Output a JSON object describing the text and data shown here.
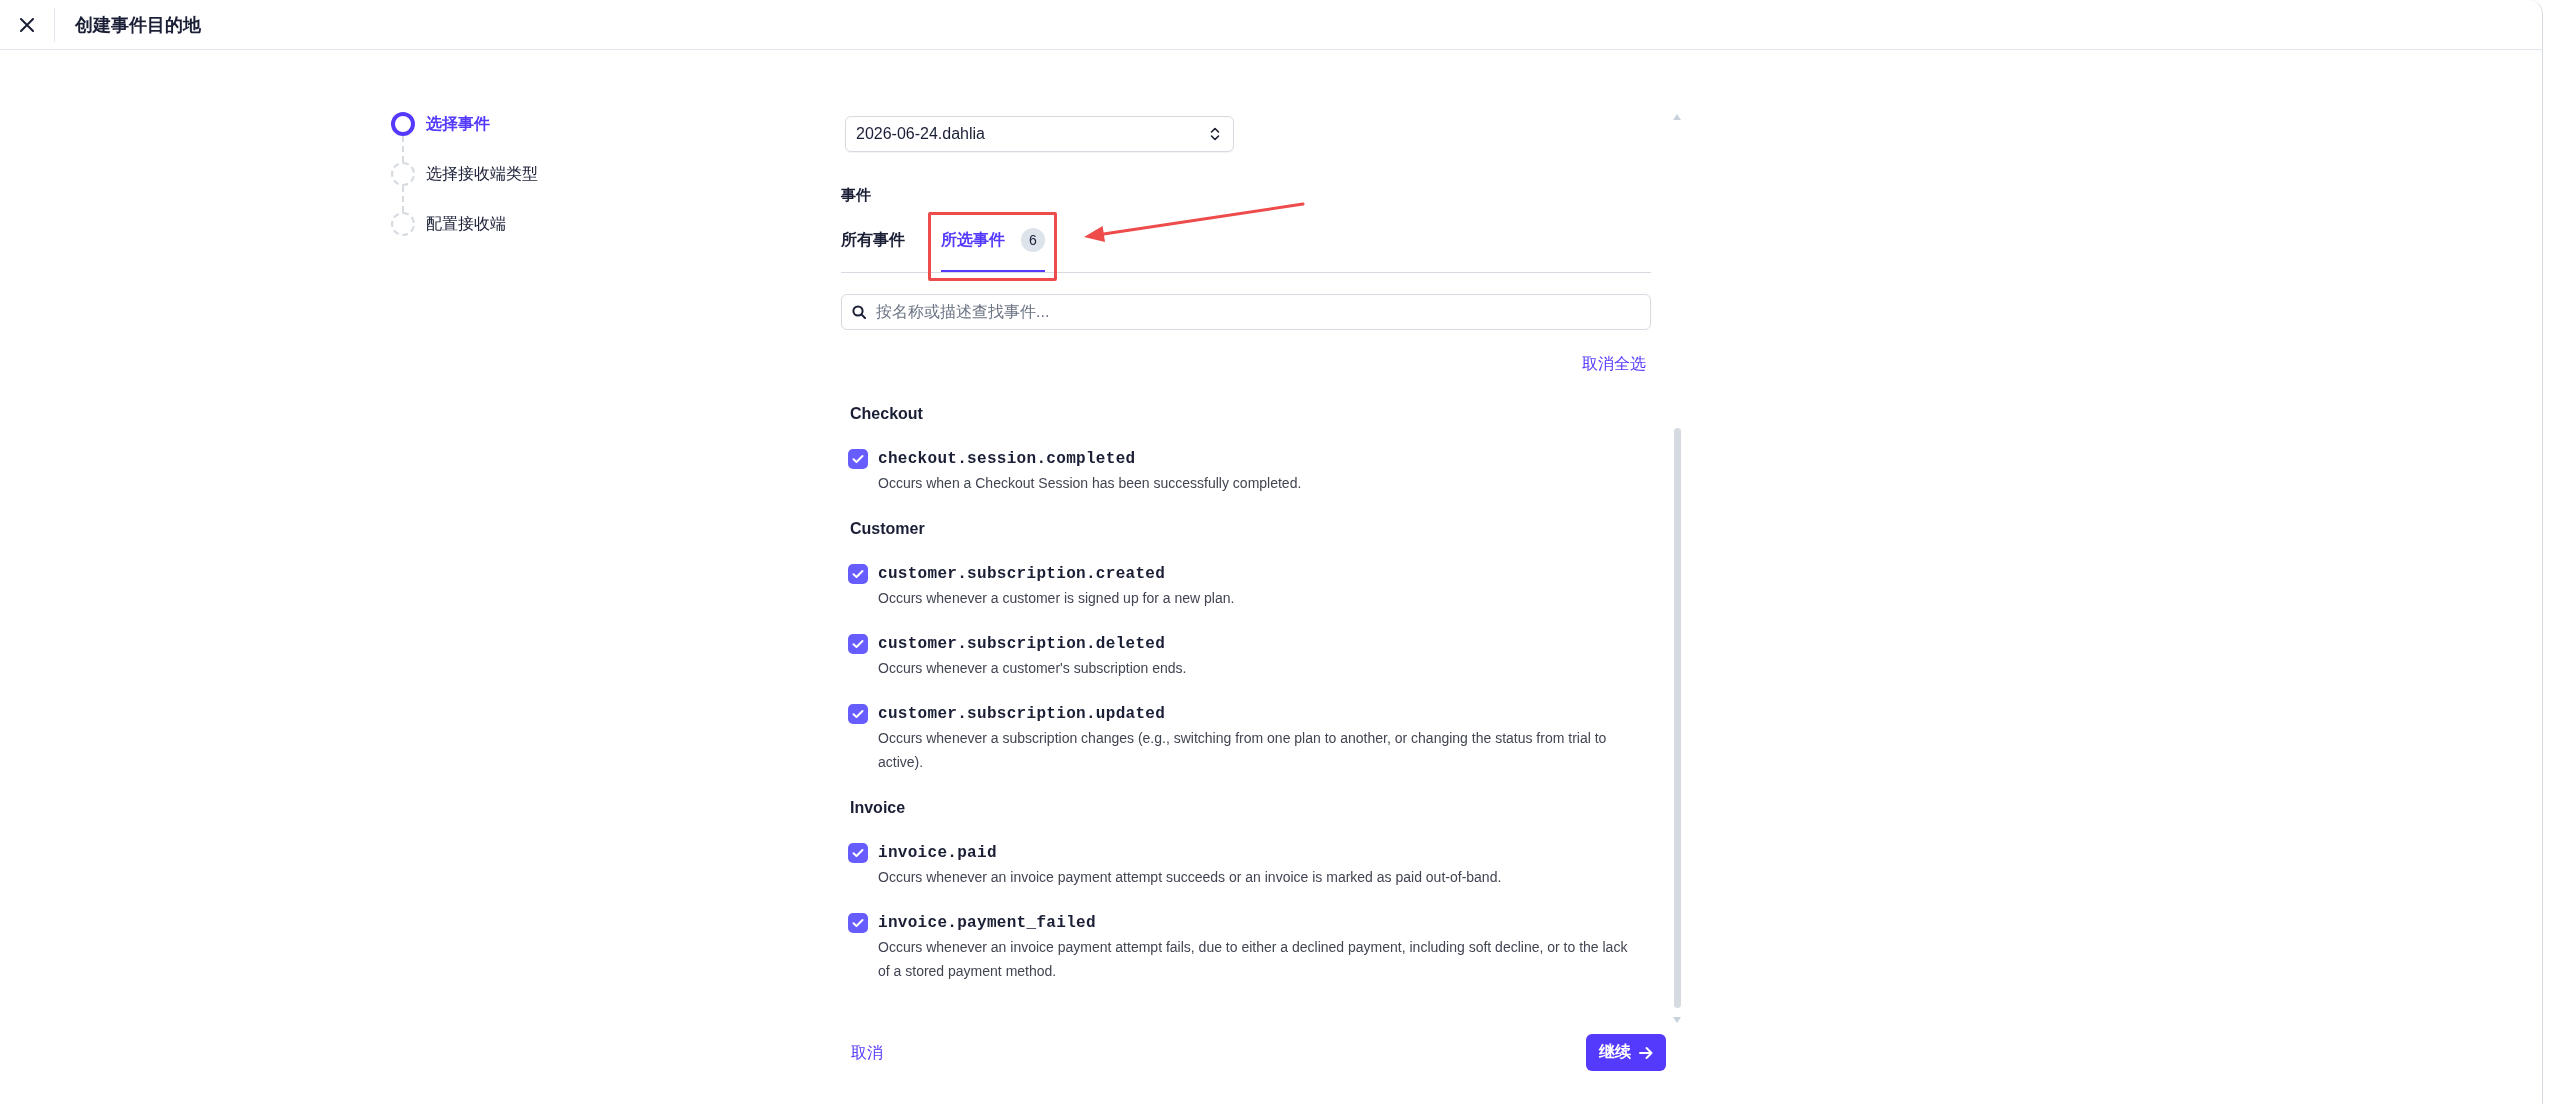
{
  "header": {
    "title": "创建事件目的地"
  },
  "steps": [
    {
      "label": "选择事件",
      "selected": true
    },
    {
      "label": "选择接收端类型",
      "selected": false
    },
    {
      "label": "配置接收端",
      "selected": false
    }
  ],
  "version_select": {
    "value": "2026-06-24.dahlia"
  },
  "events_section": {
    "label": "事件",
    "tabs": [
      {
        "label": "所有事件",
        "selected": false,
        "highlighted": false
      },
      {
        "label": "所选事件",
        "selected": true,
        "highlighted": true,
        "count": "6"
      }
    ],
    "search": {
      "placeholder": "按名称或描述查找事件..."
    },
    "deselect_all": "取消全选",
    "groups": [
      {
        "title": "Checkout",
        "events": [
          {
            "name": "checkout.session.completed",
            "description": "Occurs when a Checkout Session has been successfully completed.",
            "checked": true
          }
        ]
      },
      {
        "title": "Customer",
        "events": [
          {
            "name": "customer.subscription.created",
            "description": "Occurs whenever a customer is signed up for a new plan.",
            "checked": true
          },
          {
            "name": "customer.subscription.deleted",
            "description": "Occurs whenever a customer's subscription ends.",
            "checked": true
          },
          {
            "name": "customer.subscription.updated",
            "description": "Occurs whenever a subscription changes (e.g., switching from one plan to another, or changing the status from trial to active).",
            "checked": true
          }
        ]
      },
      {
        "title": "Invoice",
        "events": [
          {
            "name": "invoice.paid",
            "description": "Occurs whenever an invoice payment attempt succeeds or an invoice is marked as paid out-of-band.",
            "checked": true
          },
          {
            "name": "invoice.payment_failed",
            "description": "Occurs whenever an invoice payment attempt fails, due to either a declined payment, including soft decline, or to the lack of a stored payment method.",
            "checked": true
          }
        ]
      }
    ]
  },
  "footer": {
    "cancel": "取消",
    "continue": "继续"
  }
}
